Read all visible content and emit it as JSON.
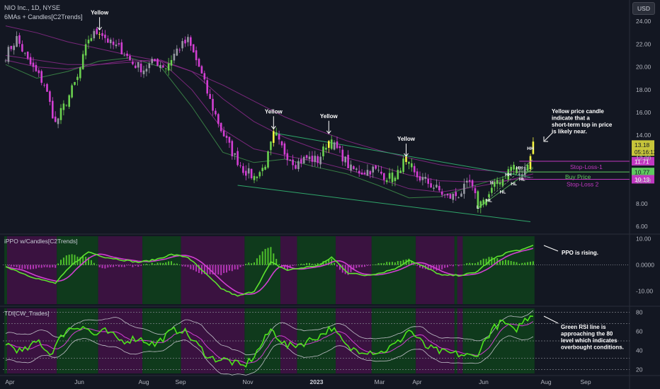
{
  "header": {
    "title": "NIO Inc., 1D, NYSE",
    "indicator": "6MAs + Candles[C2Trends]",
    "currency_button": "USD"
  },
  "colors": {
    "background": "#131722",
    "candle_green": "#6ad04f",
    "candle_magenta": "#d23fd2",
    "candle_gray": "#9598a1",
    "candle_yellow": "#f5f542",
    "ma_green": "#3e8f4a",
    "ma_purple": "#8b2a8b",
    "trend_line": "#2fa66a",
    "annotation_line": "#c037c0",
    "buy_line": "#5ec95e",
    "ppo_line": "#5ee22f",
    "ppo_signal": "#d23fd2",
    "rsi_line": "#4ee41c"
  },
  "chart_data": [
    {
      "type": "candlestick",
      "title": "NIO Inc., 1D, NYSE",
      "ylim": [
        5.5,
        25.5
      ],
      "y_ticks": [
        "24.00",
        "22.00",
        "20.00",
        "18.00",
        "16.00",
        "14.00",
        "12.00",
        "10.00",
        "8.00",
        "6.00"
      ],
      "x_ticks": [
        "Apr",
        "Jun",
        "Aug",
        "Sep",
        "Nov",
        "2023",
        "Mar",
        "Apr",
        "Jun",
        "Aug",
        "Sep"
      ],
      "price_path": [
        [
          0,
          21.0
        ],
        [
          4,
          22.5
        ],
        [
          8,
          20.5
        ],
        [
          14,
          18.5
        ],
        [
          18,
          15.0
        ],
        [
          22,
          17.0
        ],
        [
          26,
          19.0
        ],
        [
          30,
          22.5
        ],
        [
          34,
          23.2
        ],
        [
          38,
          22.0
        ],
        [
          42,
          21.5
        ],
        [
          46,
          20.3
        ],
        [
          50,
          19.8
        ],
        [
          54,
          20.5
        ],
        [
          58,
          20.0
        ],
        [
          62,
          21.5
        ],
        [
          66,
          22.3
        ],
        [
          70,
          20.0
        ],
        [
          74,
          17.0
        ],
        [
          78,
          14.5
        ],
        [
          82,
          12.5
        ],
        [
          86,
          11.0
        ],
        [
          90,
          10.3
        ],
        [
          94,
          11.3
        ],
        [
          97,
          14.0
        ],
        [
          101,
          12.5
        ],
        [
          105,
          11.5
        ],
        [
          109,
          12.0
        ],
        [
          113,
          11.8
        ],
        [
          117,
          13.5
        ],
        [
          121,
          12.5
        ],
        [
          125,
          11.0
        ],
        [
          129,
          10.8
        ],
        [
          133,
          11.0
        ],
        [
          137,
          10.5
        ],
        [
          141,
          10.1
        ],
        [
          144,
          11.6
        ],
        [
          148,
          10.5
        ],
        [
          152,
          10.0
        ],
        [
          156,
          9.3
        ],
        [
          160,
          8.5
        ],
        [
          164,
          8.8
        ],
        [
          168,
          9.8
        ],
        [
          171,
          7.9
        ],
        [
          174,
          8.4
        ],
        [
          177,
          9.5
        ],
        [
          180,
          10.2
        ],
        [
          183,
          11.2
        ],
        [
          186,
          10.4
        ],
        [
          189,
          11.3
        ],
        [
          191,
          13.4
        ]
      ],
      "ma_sets": [
        {
          "name": "ma_fast",
          "color": "ma_green",
          "values": [
            20.2,
            19.0,
            19.6,
            20.5,
            20.8,
            20.0,
            16.5,
            12.5,
            11.6,
            11.9,
            11.2,
            10.6,
            9.6,
            8.5,
            8.6,
            9.5,
            10.3,
            11.2
          ]
        },
        {
          "name": "ma_mid",
          "color": "ma_purple",
          "values": [
            20.6,
            20.0,
            19.8,
            20.2,
            20.6,
            20.5,
            18.0,
            14.5,
            12.8,
            12.2,
            11.7,
            11.0,
            10.2,
            9.3,
            9.0,
            9.4,
            9.9,
            10.6
          ]
        },
        {
          "name": "ma_slow",
          "color": "ma_purple",
          "values": [
            21.0,
            20.6,
            20.2,
            20.2,
            20.4,
            20.6,
            19.6,
            17.2,
            15.2,
            13.8,
            12.8,
            12.0,
            11.3,
            10.5,
            10.0,
            9.9,
            10.0,
            10.3
          ]
        },
        {
          "name": "ma_long",
          "color": "ma_purple",
          "values": [
            23.6,
            23.0,
            22.2,
            21.6,
            21.0,
            20.5,
            19.6,
            18.4,
            17.0,
            15.6,
            14.5,
            13.5,
            12.7,
            12.0,
            11.4,
            11.0,
            10.8,
            10.8
          ]
        }
      ],
      "last_price": "13.18",
      "countdown": "05:16:12",
      "levels": [
        {
          "price": 11.71,
          "label": "11.71",
          "name": "Stop-Loss-1",
          "color": "#c037c0"
        },
        {
          "price": 10.77,
          "label": "10.77",
          "name": "Buy Price",
          "color": "#5ec95e"
        },
        {
          "price": 10.13,
          "label": "10.13",
          "name": "Stop-Loss 2",
          "color": "#c037c0"
        }
      ],
      "trend_channel": {
        "upper": [
          [
            97,
            14.2
          ],
          [
            190,
            10.3
          ]
        ],
        "lower": [
          [
            84,
            9.6
          ],
          [
            190,
            6.4
          ]
        ]
      },
      "yellow_labels": [
        {
          "bar": 34,
          "price": 23.0,
          "text": "Yellow"
        },
        {
          "bar": 97,
          "price": 14.3,
          "text": "Yellow"
        },
        {
          "bar": 117,
          "price": 13.9,
          "text": "Yellow"
        },
        {
          "bar": 145,
          "price": 11.9,
          "text": "Yellow"
        }
      ],
      "swing_labels": [
        {
          "bar": 171,
          "price": 7.55,
          "text": "L"
        },
        {
          "bar": 175,
          "price": 8.15,
          "text": "HL"
        },
        {
          "bar": 176,
          "price": 9.7,
          "text": "H"
        },
        {
          "bar": 180,
          "price": 8.9,
          "text": "HL"
        },
        {
          "bar": 182,
          "price": 10.4,
          "text": "HH"
        },
        {
          "bar": 184,
          "price": 9.6,
          "text": "HL"
        },
        {
          "bar": 186,
          "price": 11.0,
          "text": "HH"
        },
        {
          "bar": 187,
          "price": 10.0,
          "text": "HL"
        },
        {
          "bar": 190,
          "price": 12.7,
          "text": "HH"
        }
      ],
      "note": "Yellow price candle indicate that a short-term top in price is likely near."
    },
    {
      "type": "line",
      "title": "iPPO w/Candles[C2Trends]",
      "ylim": [
        -15,
        11
      ],
      "y_ticks": [
        "10.00",
        "0.0000",
        "-10.00"
      ],
      "ppo_path": [
        [
          0,
          -0.5
        ],
        [
          8,
          -4
        ],
        [
          14,
          -6
        ],
        [
          18,
          -7
        ],
        [
          24,
          0
        ],
        [
          30,
          5
        ],
        [
          36,
          3
        ],
        [
          42,
          2
        ],
        [
          48,
          1
        ],
        [
          54,
          2
        ],
        [
          60,
          4
        ],
        [
          66,
          3
        ],
        [
          72,
          -3
        ],
        [
          78,
          -9
        ],
        [
          84,
          -12
        ],
        [
          90,
          -10
        ],
        [
          96,
          1
        ],
        [
          102,
          -2
        ],
        [
          108,
          -1
        ],
        [
          114,
          0
        ],
        [
          118,
          3
        ],
        [
          124,
          -3
        ],
        [
          130,
          -4
        ],
        [
          136,
          -3
        ],
        [
          142,
          -1
        ],
        [
          146,
          2
        ],
        [
          152,
          -1
        ],
        [
          158,
          -4
        ],
        [
          164,
          -4
        ],
        [
          170,
          -3
        ],
        [
          176,
          2
        ],
        [
          182,
          5
        ],
        [
          188,
          6
        ],
        [
          191,
          7.5
        ]
      ],
      "ppo_signal_lag": 3,
      "note": "PPO is rising."
    },
    {
      "type": "line",
      "title": "TDI[CW_Trades]",
      "ylim": [
        16,
        84
      ],
      "y_ticks": [
        "80",
        "60",
        "40",
        "20"
      ],
      "level_lines": [
        80,
        68,
        50,
        32,
        20
      ],
      "rsi_path": [
        [
          0,
          48
        ],
        [
          6,
          38
        ],
        [
          12,
          50
        ],
        [
          16,
          36
        ],
        [
          22,
          62
        ],
        [
          28,
          66
        ],
        [
          32,
          56
        ],
        [
          36,
          60
        ],
        [
          42,
          50
        ],
        [
          48,
          53
        ],
        [
          54,
          46
        ],
        [
          60,
          60
        ],
        [
          64,
          62
        ],
        [
          70,
          44
        ],
        [
          74,
          32
        ],
        [
          80,
          30
        ],
        [
          86,
          23
        ],
        [
          90,
          34
        ],
        [
          96,
          62
        ],
        [
          102,
          44
        ],
        [
          108,
          48
        ],
        [
          114,
          56
        ],
        [
          118,
          64
        ],
        [
          124,
          42
        ],
        [
          130,
          40
        ],
        [
          136,
          38
        ],
        [
          142,
          48
        ],
        [
          146,
          62
        ],
        [
          152,
          44
        ],
        [
          158,
          38
        ],
        [
          164,
          36
        ],
        [
          170,
          33
        ],
        [
          176,
          62
        ],
        [
          180,
          70
        ],
        [
          184,
          60
        ],
        [
          188,
          72
        ],
        [
          191,
          79
        ]
      ],
      "note": "Green RSI line is approaching the 80 level which indicates overbought conditions."
    }
  ]
}
